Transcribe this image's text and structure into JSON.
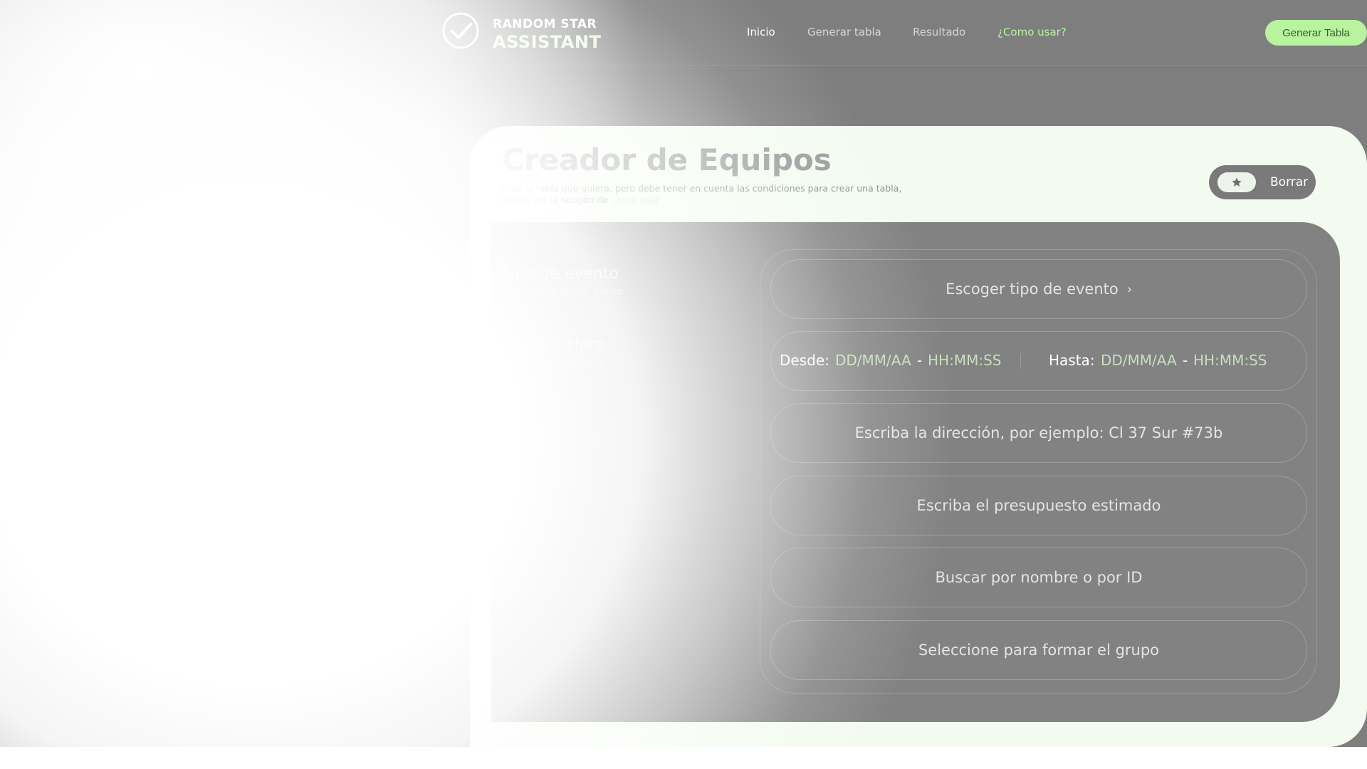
{
  "brand": {
    "line1": "RANDOM STAR",
    "line2": "ASSISTANT",
    "icon": "star-check-icon"
  },
  "nav": {
    "items": [
      {
        "label": "Inicio"
      },
      {
        "label": "Generar tabla"
      },
      {
        "label": "Resultado"
      },
      {
        "label": "¿Como usar?"
      }
    ],
    "cta_label": "Generar Tabla"
  },
  "header_section": {
    "title": "Creador de Equipos",
    "subtitle_line1": "Cree la tabla que quiera, pero debe tener en cuenta las condiciones para crear una tabla,",
    "subtitle_line2_prefix": "puede ver la sección de",
    "subtitle_link": "Como usar"
  },
  "toolbar": {
    "toggle_icon": "star-icon",
    "clear_label": "Borrar"
  },
  "form": {
    "rows": [
      {
        "label": "Tipo de evento",
        "sub": "Seleccione el tipo de evento"
      },
      {
        "label": "Fecha y Hora",
        "sub": "Seleccione fecha y hora"
      }
    ],
    "event_type_label": "Escoger tipo de evento",
    "date": {
      "from_label": "Desde:",
      "to_label": "Hasta:",
      "date_placeholder": "DD/MM/AA",
      "dash": "-",
      "time_placeholder": "HH:MM:SS"
    },
    "address_placeholder": "Escriba la dirección, por ejemplo: Cl 37 Sur #73b",
    "budget_placeholder": "Escriba el presupuesto estimado",
    "members_placeholder": "Buscar por nombre o por ID",
    "group_placeholder": "Seleccione para formar el grupo"
  },
  "colors": {
    "accent": "#b7f49d",
    "background": "#7e7e7e",
    "card": "#f3fbf0"
  }
}
